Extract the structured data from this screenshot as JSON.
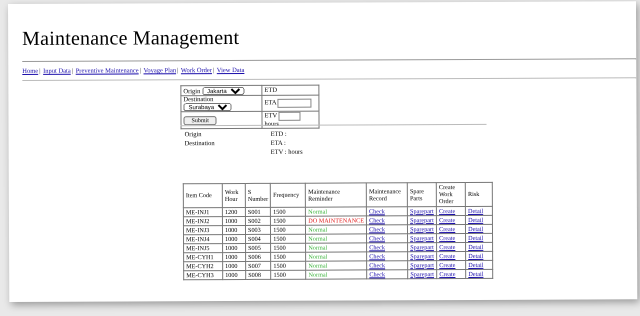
{
  "title": "Maintenance Management",
  "nav": [
    "Home",
    "Input Data",
    "Preventive Maintenance",
    "Voyage Plan",
    "Work Order",
    "View Data"
  ],
  "form": {
    "origin_label": "Origin",
    "origin_value": "Jakarta",
    "destination_label": "Destination",
    "destination_value": "Surabaya",
    "submit_label": "Submit",
    "etd_label": "ETD",
    "eta_label": "ETA",
    "etv_label": "ETV",
    "hours_label": "hours"
  },
  "summary": {
    "origin_label": "Origin",
    "destination_label": "Destination",
    "etd_label": "ETD",
    "eta_label": "ETA",
    "etv_label": "ETV",
    "hours_label": "hours"
  },
  "table": {
    "headers": [
      "Item Code",
      "Work Hour",
      "S Number",
      "Frequency",
      "Maintenance Reminder",
      "Maintenance Record",
      "Spare Parts",
      "Create Work Order",
      "Risk"
    ],
    "rows": [
      {
        "code": "ME-INJ1",
        "work_hour": "1200",
        "s_number": "S001",
        "frequency": "1500",
        "reminder": "Normal",
        "status": "normal",
        "record": "Check",
        "spare": "Sparepart",
        "create": "Create",
        "risk": "Detail"
      },
      {
        "code": "ME-INJ2",
        "work_hour": "1000",
        "s_number": "S002",
        "frequency": "1500",
        "reminder": "DO MAINTENANCE",
        "status": "alert",
        "record": "Check",
        "spare": "Sparepart",
        "create": "Create",
        "risk": "Detail"
      },
      {
        "code": "ME-INJ3",
        "work_hour": "1000",
        "s_number": "S003",
        "frequency": "1500",
        "reminder": "Normal",
        "status": "normal",
        "record": "Check",
        "spare": "Sparepart",
        "create": "Create",
        "risk": "Detail"
      },
      {
        "code": "ME-INJ4",
        "work_hour": "1000",
        "s_number": "S004",
        "frequency": "1500",
        "reminder": "Normal",
        "status": "normal",
        "record": "Check",
        "spare": "Sparepart",
        "create": "Create",
        "risk": "Detail"
      },
      {
        "code": "ME-INJ5",
        "work_hour": "1000",
        "s_number": "S005",
        "frequency": "1500",
        "reminder": "Normal",
        "status": "normal",
        "record": "Check",
        "spare": "Sparepart",
        "create": "Create",
        "risk": "Detail"
      },
      {
        "code": "ME-CYH1",
        "work_hour": "1000",
        "s_number": "S006",
        "frequency": "1500",
        "reminder": "Normal",
        "status": "normal",
        "record": "Check",
        "spare": "Sparepart",
        "create": "Create",
        "risk": "Detail"
      },
      {
        "code": "ME-CYH2",
        "work_hour": "1000",
        "s_number": "S007",
        "frequency": "1500",
        "reminder": "Normal",
        "status": "normal",
        "record": "Check",
        "spare": "Sparepart",
        "create": "Create",
        "risk": "Detail"
      },
      {
        "code": "ME-CYH3",
        "work_hour": "1000",
        "s_number": "S008",
        "frequency": "1500",
        "reminder": "Normal",
        "status": "normal",
        "record": "Check",
        "spare": "Sparepart",
        "create": "Create",
        "risk": "Detail"
      }
    ]
  },
  "colors": {
    "link": "#1a0dab",
    "normal": "#3cb43c",
    "alert": "#e02020"
  }
}
